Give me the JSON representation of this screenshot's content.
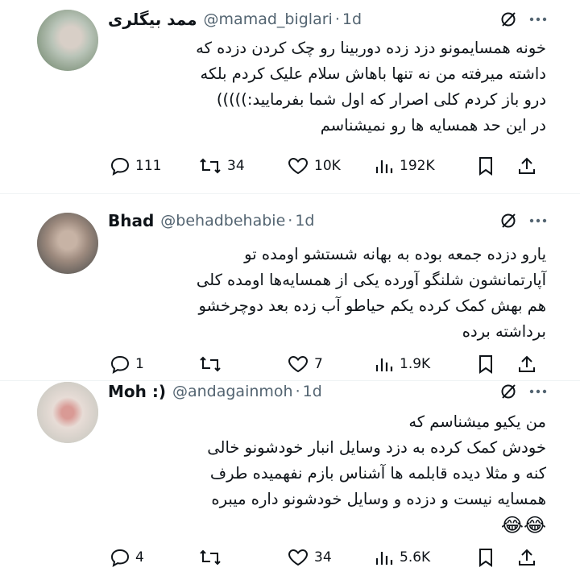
{
  "tweets": [
    {
      "name": "ممد بیگلری",
      "handle": "@mamad_biglari",
      "time": "1d",
      "text": "خونه همسایمونو دزد زده دوربینا رو چک کردن دزده که\nداشته میرفته من نه تنها باهاش سلام علیک کردم بلکه\nدرو باز کردم کلی اصرار که اول شما بفرمایید:)))))\nدر این حد همسایه ها رو نمیشناسم",
      "emoji": "",
      "replies": "111",
      "reposts": "34",
      "likes": "10K",
      "views": "192K"
    },
    {
      "name": "Bhad",
      "handle": "@behadbehabie",
      "time": "1d",
      "text": "یارو دزده جمعه بوده به بهانه شستشو اومده تو\nآپارتمانشون شلنگو آورده یکی از همسایه‌ها اومده کلی\nهم بهش کمک کرده یکم حیاطو آب زده بعد دوچرخشو\nبرداشته برده",
      "emoji": "",
      "replies": "1",
      "reposts": "",
      "likes": "7",
      "views": "1.9K"
    },
    {
      "name": "Moh :)",
      "handle": "@andagainmoh",
      "time": "1d",
      "text": "من یکیو میشناسم که\nخودش کمک کرده به دزد وسایل انبار خودشونو خالی\nکنه و مثلا دیده قابلمه ها آشناس بازم نفهمیده طرف\nهمسایه نیست و دزده و وسایل خودشونو داره میبره",
      "emoji": "😂😂",
      "replies": "4",
      "reposts": "",
      "likes": "34",
      "views": "5.6K"
    }
  ],
  "icons": {
    "grok": "grok-icon",
    "more": "more-icon",
    "reply": "reply-icon",
    "repost": "repost-icon",
    "like": "like-icon",
    "views": "views-icon",
    "bookmark": "bookmark-icon",
    "share": "share-icon"
  },
  "colors": {
    "text": "#0f1419",
    "muted": "#536471",
    "divider": "#eff3f4"
  }
}
